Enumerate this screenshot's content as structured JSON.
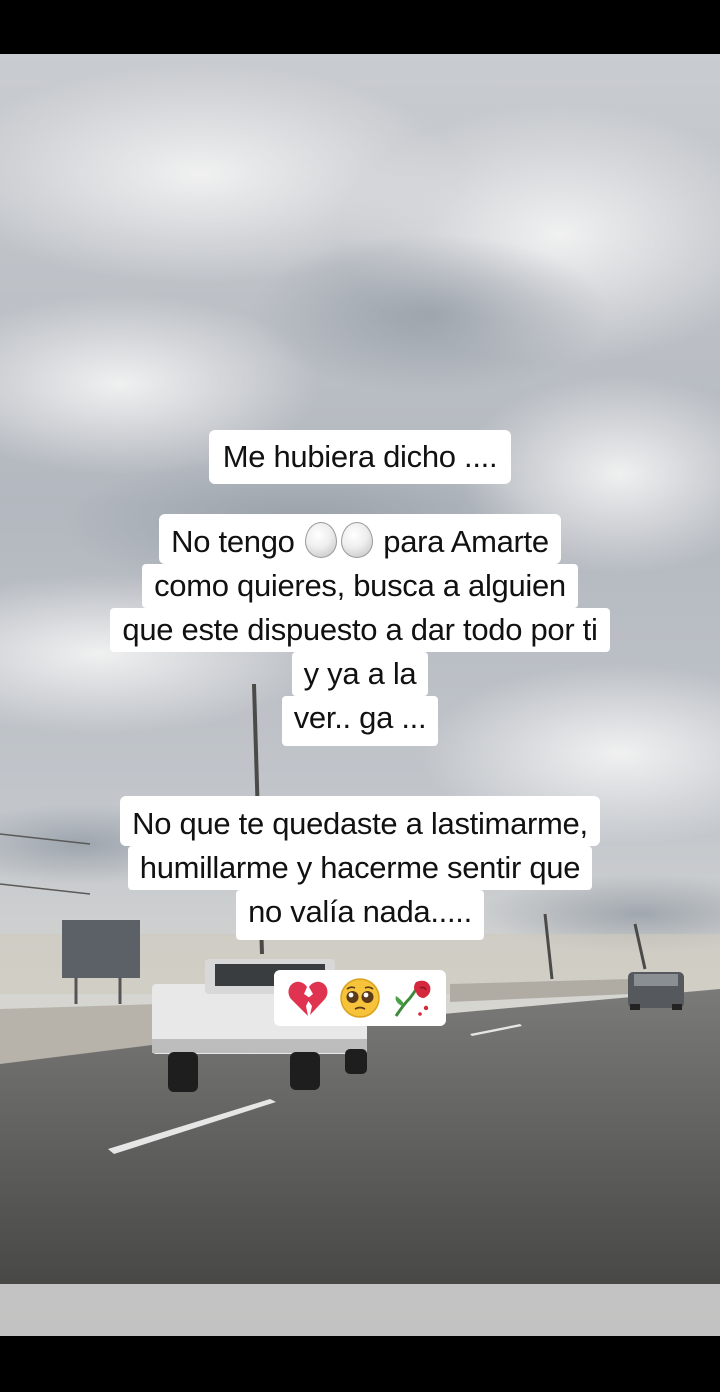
{
  "story": {
    "line1": "Me hubiera dicho ....",
    "block2": {
      "row1_before": "No tengo",
      "row1_after": "para Amarte",
      "row2": "como quieres, busca a alguien",
      "row3": "que este dispuesto a dar todo por ti",
      "row4": "y ya a la",
      "row5": "ver.. ga ..."
    },
    "block3": {
      "row1": "No que te quedaste a lastimarme,",
      "row2": "humillarme y hacerme sentir que",
      "row3": "no valía nada....."
    },
    "emojis": [
      "broken-heart-icon",
      "pleading-face-icon",
      "wilted-rose-icon"
    ],
    "egg_icons": [
      "egg-icon",
      "egg-icon"
    ]
  },
  "colors": {
    "caption_bg": "#ffffff",
    "caption_text": "#111111",
    "letterbox": "#000000"
  }
}
